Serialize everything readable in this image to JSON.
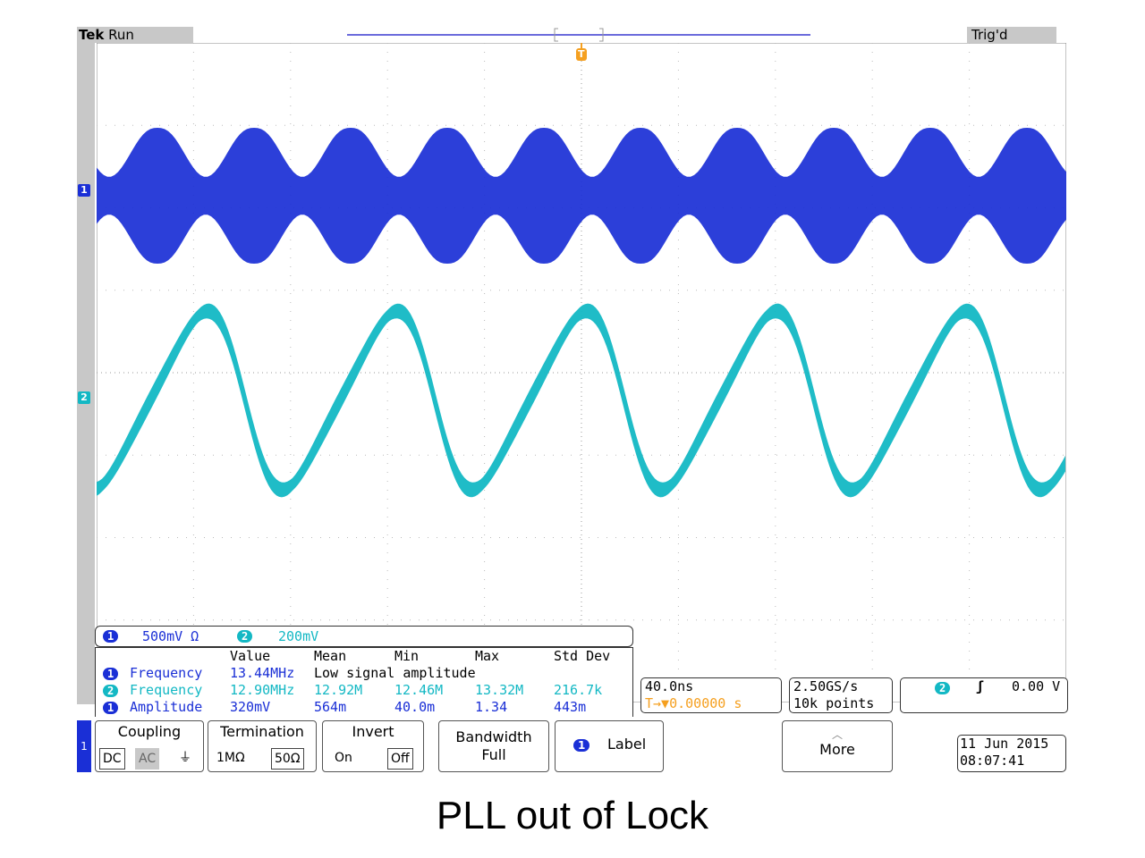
{
  "header": {
    "brand": "Tek",
    "run_state": "Run",
    "trigger_state": "Trig'd",
    "trigger_marker": "T"
  },
  "channels": [
    {
      "id": "1",
      "color": "#1a2fd6"
    },
    {
      "id": "2",
      "color": "#13b8c4"
    }
  ],
  "scale_readout": {
    "ch1": "500mV Ω",
    "ch2": "200mV"
  },
  "measurements": {
    "headers": [
      "Value",
      "Mean",
      "Min",
      "Max",
      "Std Dev"
    ],
    "rows": [
      {
        "ch": "1",
        "name": "Frequency",
        "value": "13.44MHz",
        "rest": "Low signal amplitude"
      },
      {
        "ch": "2",
        "name": "Frequency",
        "value": "12.90MHz",
        "mean": "12.92M",
        "min": "12.46M",
        "max": "13.32M",
        "std": "216.7k"
      },
      {
        "ch": "1",
        "name": "Amplitude",
        "value": "320mV",
        "mean": "564m",
        "min": "40.0m",
        "max": "1.34",
        "std": "443m"
      }
    ]
  },
  "timebase": {
    "scale": "40.0ns",
    "position": "T→▼0.00000 s"
  },
  "acquisition": {
    "rate": "2.50GS/s",
    "points": "10k points"
  },
  "trigger": {
    "channel": "2",
    "slope_icon": "ʃ",
    "level": "0.00 V"
  },
  "menu": {
    "channel_tab": "1",
    "coupling": {
      "label": "Coupling",
      "options": [
        "DC",
        "AC",
        "⏚"
      ],
      "selected": "AC"
    },
    "termination": {
      "label": "Termination",
      "options": [
        "1MΩ",
        "50Ω"
      ]
    },
    "invert": {
      "label": "Invert",
      "options": [
        "On",
        "Off"
      ]
    },
    "bandwidth": {
      "label": "Bandwidth",
      "value": "Full"
    },
    "label_button": {
      "badge": "1",
      "label": "Label"
    },
    "more": {
      "label": "More"
    }
  },
  "datetime": {
    "date": "11 Jun 2015",
    "time": "08:07:41"
  },
  "caption": "PLL out of Lock"
}
